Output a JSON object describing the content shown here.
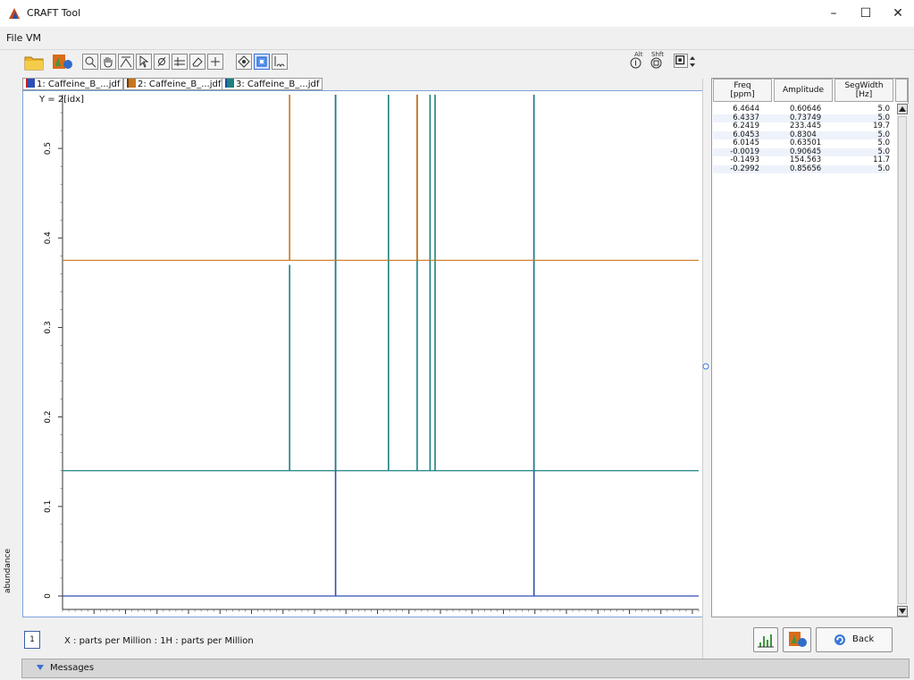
{
  "window": {
    "title": "CRAFT Tool",
    "controls": [
      "–",
      "☐",
      "✕"
    ]
  },
  "menu": [
    "File",
    "VM"
  ],
  "toolbar": {
    "right_labels": [
      "Alt",
      "Shft"
    ]
  },
  "tabs": [
    {
      "label": "1: Caffeine_B_...jdf",
      "color": "#2d4fb5"
    },
    {
      "label": "2: Caffeine_B_...jdf",
      "color": "#c8761c"
    },
    {
      "label": "3: Caffeine_B_...jdf",
      "color": "#1e8080"
    }
  ],
  "plot": {
    "y_formula": "Y = 2[idx]",
    "y_axis_label": "abundance",
    "x_axis_label": "X : parts per Million : 1H : parts per Million",
    "page_indicator": "1"
  },
  "chart_data": {
    "type": "line",
    "xlim": [
      15.0,
      -5.2
    ],
    "ylim": [
      -0.015,
      0.56
    ],
    "x_ticks": [
      "14.0",
      "13.0",
      "12.0",
      "11.0",
      "10.0",
      "9.0",
      "8.0",
      "7.0",
      "6.0",
      "5.0",
      "4.0",
      "3.0",
      "2.0",
      "1.0",
      "0",
      "-1.0",
      "-2.0",
      "-3.0",
      "-4.0",
      "-5"
    ],
    "y_ticks": [
      "0",
      "0.1",
      "0.2",
      "0.3",
      "0.4",
      "0.5"
    ],
    "series": [
      {
        "color": "#2d4fb5",
        "baseline": 0.0,
        "peaks": [
          {
            "x": 6.33,
            "y": 1.0
          },
          {
            "x": 0.03,
            "y": 1.0
          }
        ]
      },
      {
        "color": "#1e8080",
        "baseline": 0.14,
        "peaks": [
          {
            "x": 7.79,
            "y": 0.23
          },
          {
            "x": 6.33,
            "y": 1.0
          },
          {
            "x": 4.65,
            "y": 1.0
          },
          {
            "x": 3.74,
            "y": 1.0
          },
          {
            "x": 3.33,
            "y": 1.0
          },
          {
            "x": 3.17,
            "y": 1.0
          },
          {
            "x": 0.03,
            "y": 0.51
          }
        ]
      },
      {
        "color": "#c8761c",
        "baseline": 0.375,
        "peaks": [
          {
            "x": 7.79,
            "y": 0.45
          },
          {
            "x": 3.74,
            "y": 1.0
          }
        ]
      }
    ]
  },
  "table": {
    "headers": [
      "Freq\n[ppm]",
      "Amplitude",
      "SegWidth\n[Hz]"
    ],
    "rows": [
      [
        "6.4644",
        "0.60646",
        "5.0"
      ],
      [
        "6.4337",
        "0.73749",
        "5.0"
      ],
      [
        "6.2419",
        "233.445",
        "19.7"
      ],
      [
        "6.0453",
        "0.8304",
        "5.0"
      ],
      [
        "6.0145",
        "0.63501",
        "5.0"
      ],
      [
        "-0.0019",
        "0.90645",
        "5.0"
      ],
      [
        "-0.1493",
        "154.563",
        "11.7"
      ],
      [
        "-0.2992",
        "0.85656",
        "5.0"
      ]
    ]
  },
  "buttons": {
    "back": "Back"
  },
  "messages": {
    "label": "Messages"
  }
}
